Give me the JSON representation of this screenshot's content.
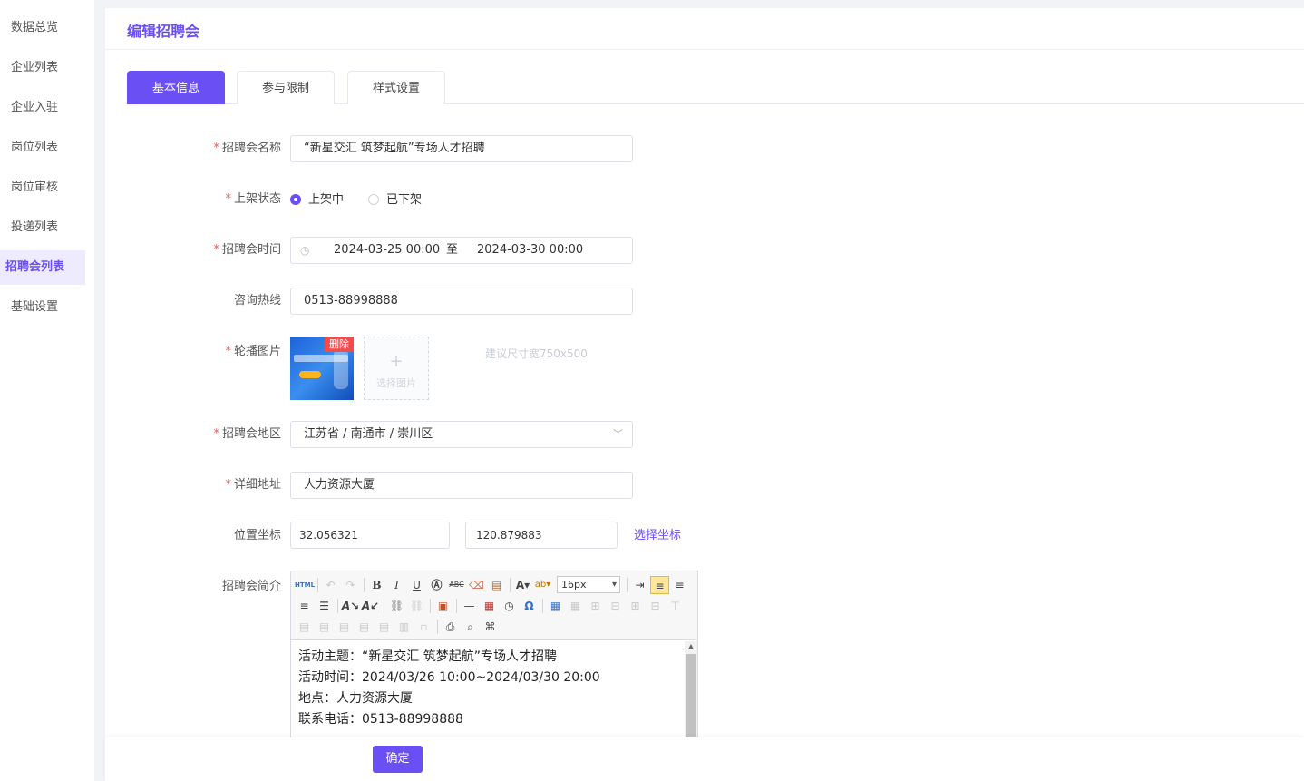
{
  "sidebar": {
    "items": [
      {
        "label": "数据总览"
      },
      {
        "label": "企业列表"
      },
      {
        "label": "企业入驻"
      },
      {
        "label": "岗位列表"
      },
      {
        "label": "岗位审核"
      },
      {
        "label": "投递列表"
      },
      {
        "label": "招聘会列表",
        "active": true
      },
      {
        "label": "基础设置"
      }
    ]
  },
  "page": {
    "title": "编辑招聘会"
  },
  "tabs": [
    {
      "label": "基本信息",
      "active": true
    },
    {
      "label": "参与限制"
    },
    {
      "label": "样式设置"
    }
  ],
  "form": {
    "name": {
      "label": "招聘会名称",
      "required": true,
      "value": "“新星交汇 筑梦起航”专场人才招聘"
    },
    "status": {
      "label": "上架状态",
      "required": true,
      "options": [
        {
          "label": "上架中",
          "checked": true
        },
        {
          "label": "已下架",
          "checked": false
        }
      ]
    },
    "time": {
      "label": "招聘会时间",
      "required": true,
      "start": "2024-03-25 00:00",
      "separator": "至",
      "end": "2024-03-30 00:00"
    },
    "hotline": {
      "label": "咨询热线",
      "required": false,
      "value": "0513-88998888"
    },
    "carousel": {
      "label": "轮播图片",
      "required": true,
      "delete_label": "删除",
      "upload_label": "选择图片",
      "upload_plus": "+",
      "hint": "建议尺寸宽750x500"
    },
    "region": {
      "label": "招聘会地区",
      "required": true,
      "value": "江苏省 / 南通市 / 崇川区"
    },
    "address": {
      "label": "详细地址",
      "required": true,
      "value": "人力资源大厦"
    },
    "coords": {
      "label": "位置坐标",
      "required": false,
      "lat": "32.056321",
      "lng": "120.879883",
      "pick_label": "选择坐标"
    },
    "intro": {
      "label": "招聘会简介",
      "required": false,
      "font_size": "16px",
      "lines": [
        "活动主题：“新星交汇 筑梦起航”专场人才招聘",
        "活动时间：2024/03/26 10:00~2024/03/30 20:00",
        "地点：人力资源大厦",
        "联系电话：0513-88998888"
      ]
    }
  },
  "footer": {
    "confirm_label": "确定"
  },
  "colors": {
    "accent": "#6a4ff5",
    "required": "#f05a5a",
    "delete": "#f24b4b"
  }
}
